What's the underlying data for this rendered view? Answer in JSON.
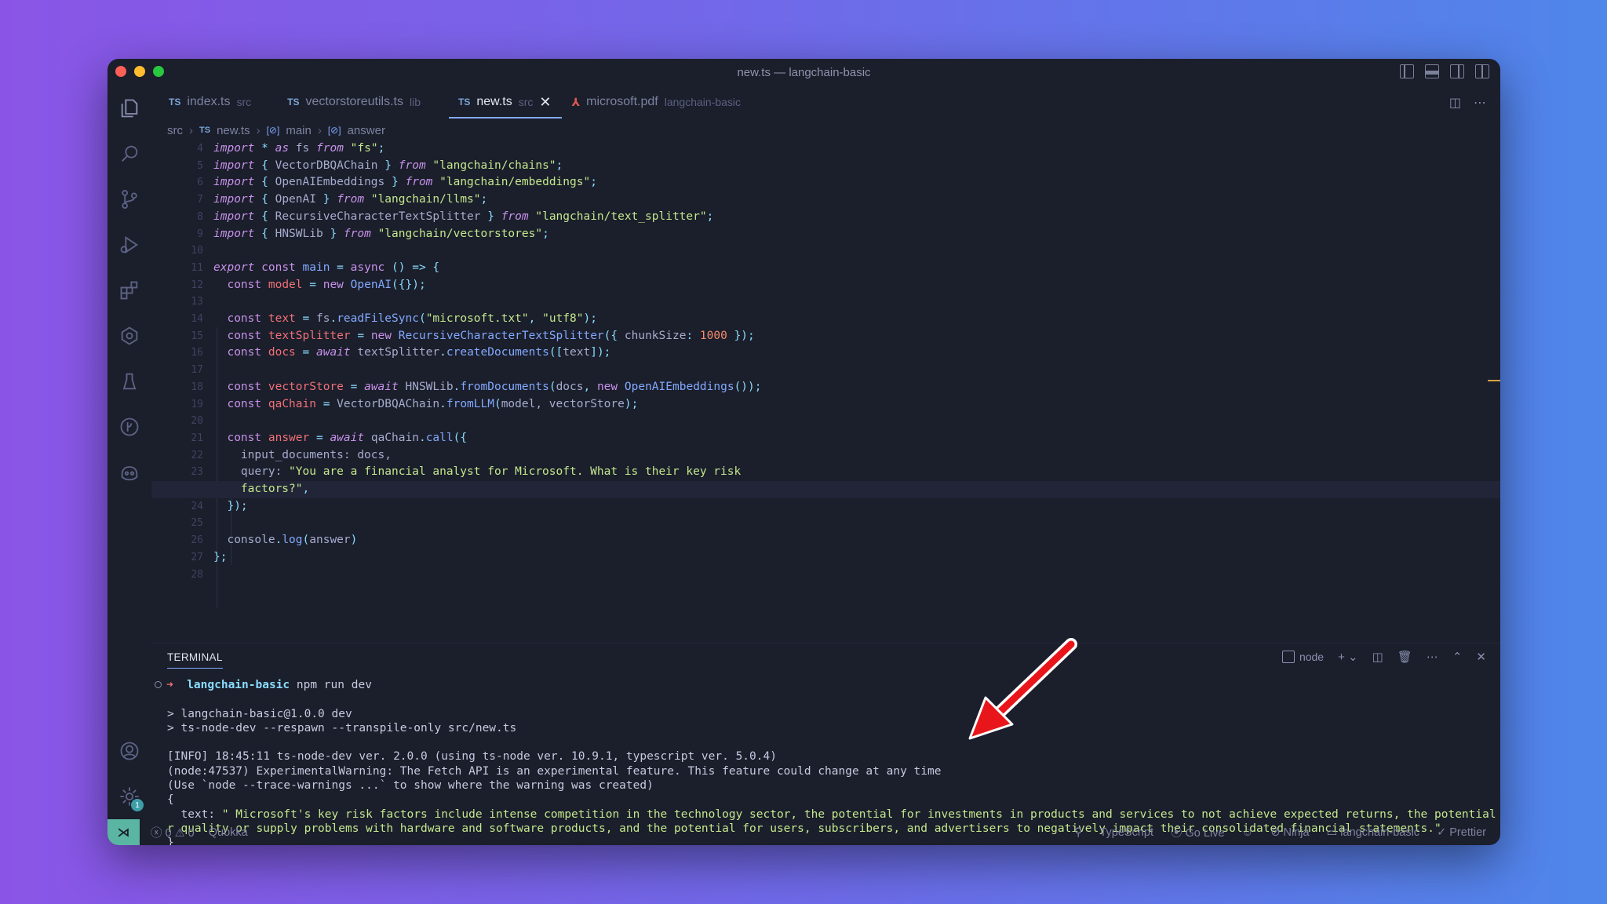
{
  "window": {
    "title": "new.ts — langchain-basic"
  },
  "tabs": [
    {
      "label": "index.ts",
      "hint": "src",
      "type": "TS"
    },
    {
      "label": "vectorstoreutils.ts",
      "hint": "lib",
      "type": "TS"
    },
    {
      "label": "new.ts",
      "hint": "src",
      "type": "TS"
    },
    {
      "label": "microsoft.pdf",
      "hint": "langchain-basic",
      "type": "pdf"
    }
  ],
  "breadcrumb": {
    "folder": "src",
    "file": "new.ts",
    "fn": "main",
    "var": "answer"
  },
  "editor": {
    "lines": [
      {
        "n": "4"
      },
      {
        "n": "5"
      },
      {
        "n": "6"
      },
      {
        "n": "7"
      },
      {
        "n": "8"
      },
      {
        "n": "9"
      },
      {
        "n": "10"
      },
      {
        "n": "11"
      },
      {
        "n": "12"
      },
      {
        "n": "13"
      },
      {
        "n": "14"
      },
      {
        "n": "15"
      },
      {
        "n": "16"
      },
      {
        "n": "17"
      },
      {
        "n": "18"
      },
      {
        "n": "19"
      },
      {
        "n": "20"
      },
      {
        "n": "21"
      },
      {
        "n": "22"
      },
      {
        "n": "23"
      },
      {
        "n": ""
      },
      {
        "n": "24"
      },
      {
        "n": "25"
      },
      {
        "n": "26"
      },
      {
        "n": "27"
      },
      {
        "n": "28"
      }
    ],
    "code": {
      "l4": [
        "import",
        "*",
        "as",
        "fs",
        "from",
        "\"fs\""
      ],
      "l5_mod": "VectorDBQAChain",
      "l5_src": "\"langchain/chains\"",
      "l6_mod": "OpenAIEmbeddings",
      "l6_src": "\"langchain/embeddings\"",
      "l7_mod": "OpenAI",
      "l7_src": "\"langchain/llms\"",
      "l8_mod": "RecursiveCharacterTextSplitter",
      "l8_src": "\"langchain/text_splitter\"",
      "l9_mod": "HNSWLib",
      "l9_src": "\"langchain/vectorstores\"",
      "l11_name": "main",
      "l12_var": "model",
      "l12_cls": "OpenAI",
      "l14_var": "text",
      "l14_obj": "fs",
      "l14_fn": "readFileSync",
      "l14_a1": "\"microsoft.txt\"",
      "l14_a2": "\"utf8\"",
      "l15_var": "textSplitter",
      "l15_cls": "RecursiveCharacterTextSplitter",
      "l15_key": "chunkSize",
      "l15_num": "1000",
      "l16_var": "docs",
      "l16_obj": "textSplitter",
      "l16_fn": "createDocuments",
      "l16_arg": "text",
      "l18_var": "vectorStore",
      "l18_obj": "HNSWLib",
      "l18_fn": "fromDocuments",
      "l18_arg": "docs",
      "l18_cls": "OpenAIEmbeddings",
      "l19_var": "qaChain",
      "l19_obj": "VectorDBQAChain",
      "l19_fn": "fromLLM",
      "l19_args": "model, vectorStore",
      "l21_var": "answer",
      "l21_obj": "qaChain",
      "l21_fn": "call",
      "l22": "input_documents: docs,",
      "l23_key": "query:",
      "l23_str": "\"You are a financial analyst for Microsoft. What is their key risk",
      "l23b_str": "factors?\"",
      "l26_obj": "console",
      "l26_fn": "log",
      "l26_arg": "answer"
    }
  },
  "terminal": {
    "header": "TERMINAL",
    "shell": "node",
    "prompt_dir": "langchain-basic",
    "prompt_cmd": "npm run dev",
    "lines": [
      "> langchain-basic@1.0.0 dev",
      "> ts-node-dev --respawn --transpile-only src/new.ts",
      "[INFO] 18:45:11 ts-node-dev ver. 2.0.0 (using ts-node ver. 10.9.1, typescript ver. 5.0.4)",
      "(node:47537) ExperimentalWarning: The Fetch API is an experimental feature. This feature could change at any time",
      "(Use `node --trace-warnings ...` to show where the warning was created)",
      "{",
      "  text: ",
      "\" Microsoft's key risk factors include intense competition in the technology sector, the potential for investments in products and services to not achieve expected returns, the potential fo",
      "r quality or supply problems with hardware and software products, and the potential for users, subscribers, and advertisers to negatively impact their consolidated financial statements.\"",
      "}"
    ]
  },
  "status": {
    "errors": "0",
    "warnings": "0",
    "quokka": "Quokka",
    "language": "TypeScript",
    "golive": "Go Live",
    "ninja": "Ninja",
    "project": "langchain-basic",
    "prettier": "Prettier",
    "settings_badge": "1"
  },
  "colors": {
    "accent": "#82aaff",
    "arrow": "#e8161b",
    "remote": "#5ab6a2"
  }
}
